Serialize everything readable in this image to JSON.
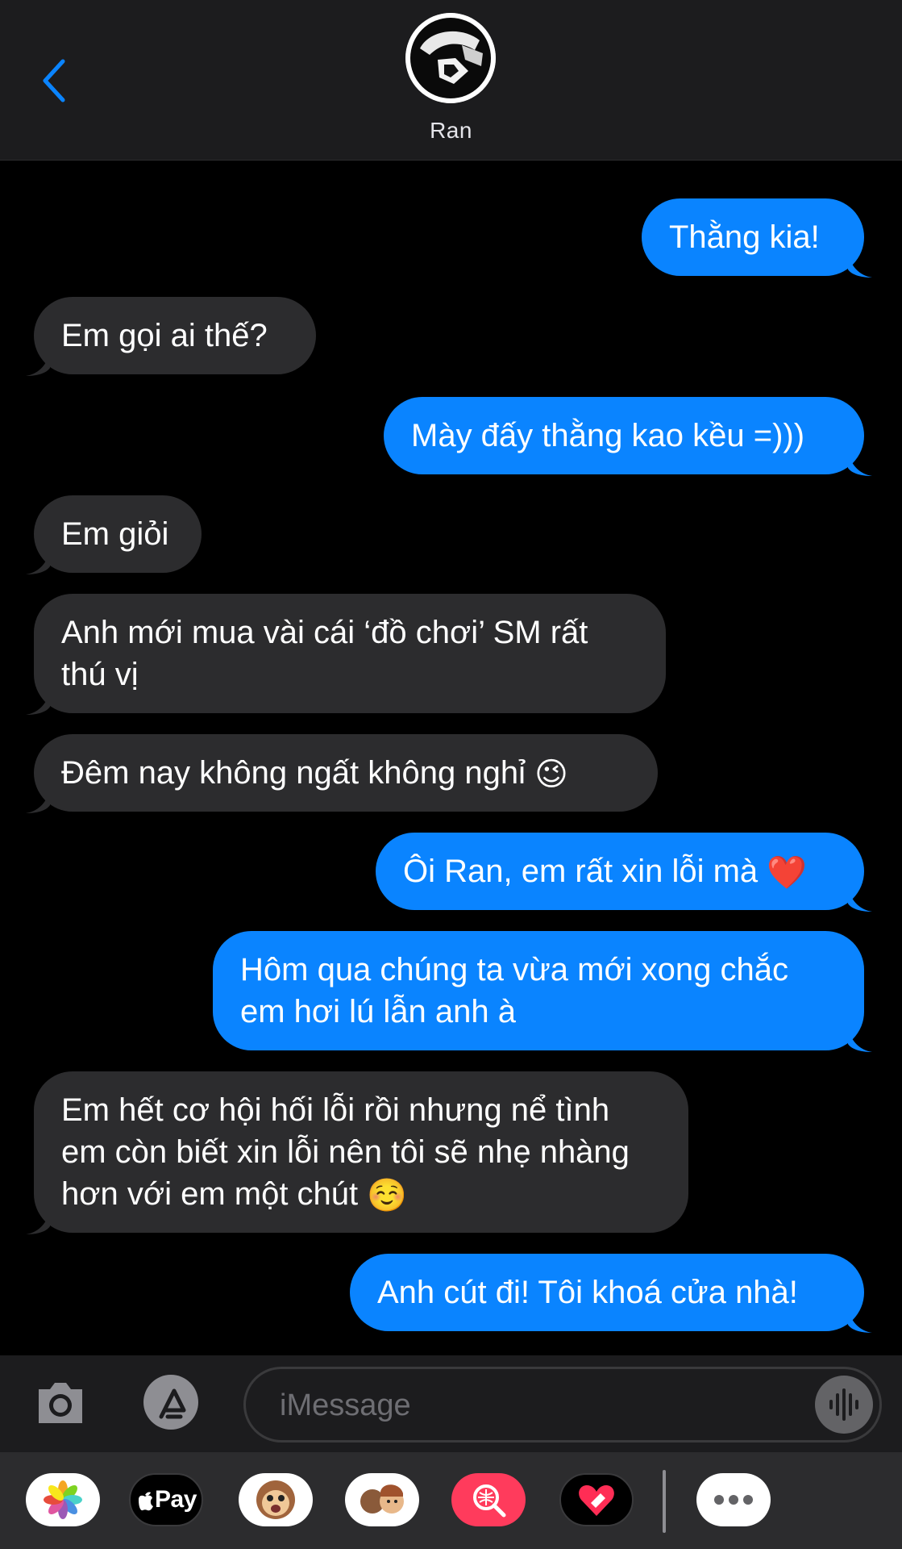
{
  "header": {
    "contact_name": "Ran",
    "back_icon": "chevron-left-icon",
    "accent": "#0a84ff"
  },
  "messages": [
    {
      "side": "outgoing",
      "text": "Thằng kia!"
    },
    {
      "side": "incoming",
      "text": "Em gọi ai thế?"
    },
    {
      "side": "outgoing",
      "text": "Mày đấy thằng kao kều =)))"
    },
    {
      "side": "incoming",
      "text": "Em giỏi"
    },
    {
      "side": "incoming",
      "text": "Anh mới mua vài cái ‘đồ chơi’ SM rất thú vị"
    },
    {
      "side": "incoming",
      "text": "Đêm nay không ngất không nghỉ",
      "emoji": "😉"
    },
    {
      "side": "outgoing",
      "text": "Ôi Ran, em rất xin lỗi mà",
      "emoji": "❤️"
    },
    {
      "side": "outgoing",
      "text": "Hôm qua chúng ta vừa mới xong chắc em hơi lú lẫn anh à"
    },
    {
      "side": "incoming",
      "text": "Em hết cơ hội hối lỗi rồi nhưng nể tình em còn biết xin lỗi nên tôi sẽ nhẹ nhàng hơn với em một chút",
      "emoji": "☺️"
    },
    {
      "side": "outgoing",
      "text": "Anh cút đi! Tôi khoá cửa nhà!"
    }
  ],
  "composer": {
    "placeholder": "iMessage",
    "camera_icon": "camera-icon",
    "appstore_icon": "app-store-icon",
    "audio_icon": "audio-waveform-icon"
  },
  "app_drawer": {
    "items": [
      {
        "name": "photos-app-icon"
      },
      {
        "name": "apple-pay-app-icon",
        "label": "Pay"
      },
      {
        "name": "animoji-app-icon"
      },
      {
        "name": "memoji-app-icon"
      },
      {
        "name": "image-search-app-icon"
      },
      {
        "name": "digital-touch-app-icon"
      },
      {
        "name": "more-apps-icon"
      }
    ]
  },
  "colors": {
    "incoming_bubble": "#2c2c2e",
    "outgoing_bubble": "#0a84ff",
    "background": "#000000"
  }
}
